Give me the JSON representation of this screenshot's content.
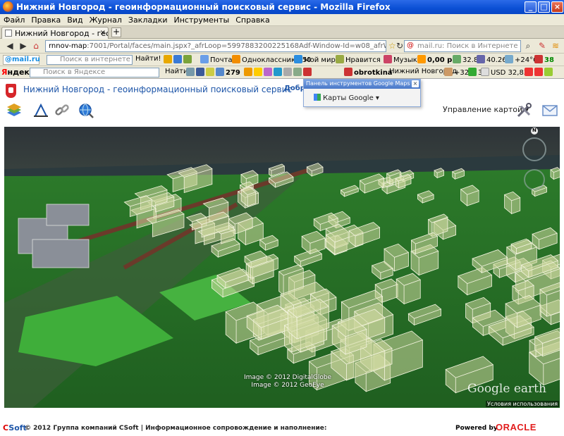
{
  "window": {
    "title": "Нижний Новгород - геоинформационный поисковый сервис - Mozilla Firefox",
    "controls": [
      "_",
      "□",
      "×"
    ]
  },
  "menu": [
    "Файл",
    "Правка",
    "Вид",
    "Журнал",
    "Закладки",
    "Инструменты",
    "Справка"
  ],
  "tabs": [
    {
      "label": "Нижний Новгород - геоинформа...",
      "close": "×"
    }
  ],
  "new_tab": "+",
  "nav": {
    "url_host": "rnnov-map",
    "url_rest": ":7001/Portal/faces/main.jspx?_afrLoop=5997883200225168Adf-Window-Id=w08_afrWindowMode=08_adf.c",
    "search_placeholder": "mail.ru: Поиск в Интернете"
  },
  "toolbar_mailru": {
    "logo": "@mail.ru",
    "search_placeholder": "Поиск в интернете",
    "find": "Найти!",
    "mail": "Почта",
    "odnoklassniki": "Одноклассники 50",
    "moy_mir": "Мой мир",
    "likes": "Нравится",
    "music": "Музыка",
    "balance": "0,00 р.",
    "usd": "32.83",
    "eur": "40.26",
    "weather": "+24°C",
    "count": "38"
  },
  "toolbar_yandex": {
    "logo_first": "Я",
    "logo_rest": "ндекс",
    "search_placeholder": "Поиск в Яндексе",
    "find": "Найти",
    "mail_count": "279",
    "user": "obrotkina",
    "city": "Нижний Новгород",
    "temp": "+32",
    "num": "3",
    "usd": "USD 32,83"
  },
  "page": {
    "site_title": "Нижний Новгород - геоинформационный поисковый сервис",
    "greeting": "Добро",
    "map_management": "Управление картой ▾"
  },
  "popup": {
    "title": "Панель инструментов Google Maps",
    "close": "×",
    "maps_label": "Карты Google ▾"
  },
  "map": {
    "credit_1": "Image © 2012 DigitalGlobe",
    "credit_2": "Image © 2012 GeoEye",
    "brand": "Google earth",
    "terms": "Условия использования",
    "compass_n": "N"
  },
  "footer": {
    "csoft_c": "C",
    "csoft_rest": "Soft",
    "copyright": "© 2012 Группа компаний CSoft | Информационное сопровождение и наполнение:",
    "powered_by": "Powered by",
    "oracle": "ORACLE"
  },
  "colors": {
    "titlebar": "#0a4fd4",
    "chrome": "#ece9d8",
    "link": "#1d55a8",
    "oracle_red": "#e21d1d",
    "building_overlay": "#2fbf3a"
  }
}
